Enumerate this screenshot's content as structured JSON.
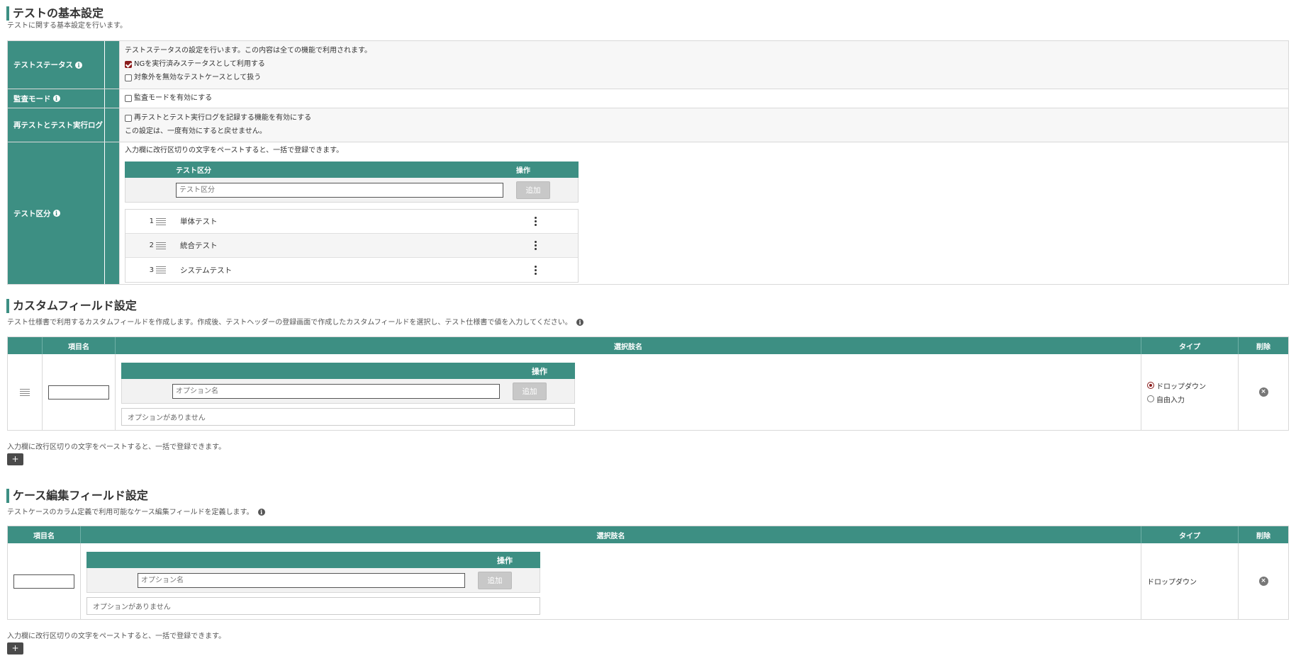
{
  "basic": {
    "title": "テストの基本設定",
    "desc": "テストに関する基本設定を行います。",
    "status": {
      "label": "テストステータス",
      "desc": "テストステータスの設定を行います。この内容は全ての機能で利用されます。",
      "opt1": "NGを実行済みステータスとして利用する",
      "opt2": "対象外を無効なテストケースとして扱う"
    },
    "audit": {
      "label": "監査モード",
      "opt": "監査モードを有効にする"
    },
    "retest": {
      "label": "再テストとテスト実行ログ",
      "opt": "再テストとテスト実行ログを記録する機能を有効にする",
      "note": "この設定は、一度有効にすると戻せません。"
    },
    "category": {
      "label": "テスト区分",
      "note": "入力欄に改行区切りの文字をペーストすると、一括で登録できます。",
      "col_name": "テスト区分",
      "col_op": "操作",
      "placeholder": "テスト区分",
      "add": "追加",
      "items": [
        {
          "num": "1",
          "name": "単体テスト"
        },
        {
          "num": "2",
          "name": "統合テスト"
        },
        {
          "num": "3",
          "name": "システムテスト"
        }
      ]
    }
  },
  "custom": {
    "title": "カスタムフィールド設定",
    "desc": "テスト仕様書で利用するカスタムフィールドを作成します。作成後、テストヘッダーの登録画面で作成したカスタムフィールドを選択し、テスト仕様書で値を入力してください。",
    "col_item": "項目名",
    "col_choice": "選択肢名",
    "col_type": "タイプ",
    "col_delete": "削除",
    "inner_op": "操作",
    "placeholder": "オプション名",
    "add": "追加",
    "empty": "オプションがありません",
    "type_dropdown": "ドロップダウン",
    "type_free": "自由入力",
    "paste_note": "入力欄に改行区切りの文字をペーストすると、一括で登録できます。",
    "plus": "+"
  },
  "case": {
    "title": "ケース編集フィールド設定",
    "desc": "テストケースのカラム定義で利用可能なケース編集フィールドを定義します。",
    "col_item": "項目名",
    "col_choice": "選択肢名",
    "col_type": "タイプ",
    "col_delete": "削除",
    "inner_op": "操作",
    "placeholder": "オプション名",
    "add": "追加",
    "empty": "オプションがありません",
    "type_value": "ドロップダウン",
    "paste_note": "入力欄に改行区切りの文字をペーストすると、一括で登録できます。",
    "plus": "+"
  },
  "colors": {
    "accent": "#3d8f83",
    "check": "#8a1c1c"
  }
}
